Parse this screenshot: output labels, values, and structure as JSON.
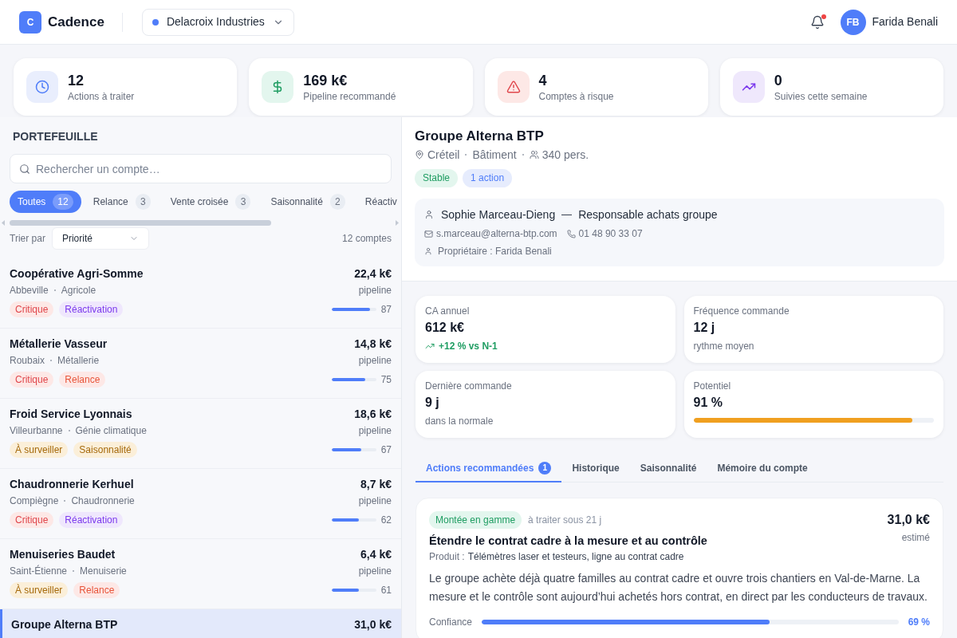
{
  "header": {
    "logo_letter": "C",
    "app_name": "Cadence",
    "organization": "Delacroix Industries",
    "notifications": {
      "unread": true
    },
    "user": {
      "initials": "FB",
      "name": "Farida Benali"
    }
  },
  "kpis": [
    {
      "kind": "actions",
      "value": "12",
      "label": "Actions à traiter"
    },
    {
      "kind": "pipeline",
      "value": "169 k€",
      "label": "Pipeline recommandé"
    },
    {
      "kind": "risk",
      "value": "4",
      "label": "Comptes à risque"
    },
    {
      "kind": "followup",
      "value": "0",
      "label": "Suivies cette semaine"
    }
  ],
  "portfolio": {
    "title": "PORTEFEUILLE",
    "search": {
      "placeholder": "Rechercher un compte…"
    },
    "filters": [
      {
        "label": "Toutes",
        "count": "12",
        "selected": true
      },
      {
        "label": "Relance",
        "count": "3",
        "selected": false
      },
      {
        "label": "Vente croisée",
        "count": "3",
        "selected": false
      },
      {
        "label": "Saisonnalité",
        "count": "2",
        "selected": false
      },
      {
        "label": "Réactiv",
        "selected": false
      }
    ],
    "sort": {
      "label": "Trier par",
      "value": "Priorité"
    },
    "count": "12 comptes",
    "accounts": [
      {
        "name": "Coopérative Agri-Somme",
        "city": "Abbeville",
        "sector": "Agricole",
        "tags": [
          {
            "kind": "critical",
            "label": "Critique"
          },
          {
            "kind": "reactivation",
            "label": "Réactivation"
          }
        ],
        "amount": "22,4 k€",
        "amount_note": "pipeline",
        "level": 0.87,
        "score": "87",
        "selected": false
      },
      {
        "name": "Métallerie Vasseur",
        "city": "Roubaix",
        "sector": "Métallerie",
        "tags": [
          {
            "kind": "critical",
            "label": "Critique"
          },
          {
            "kind": "followup",
            "label": "Relance"
          }
        ],
        "amount": "14,8 k€",
        "amount_note": "pipeline",
        "level": 0.75,
        "score": "75",
        "selected": false
      },
      {
        "name": "Froid Service Lyonnais",
        "city": "Villeurbanne",
        "sector": "Génie climatique",
        "tags": [
          {
            "kind": "watch",
            "label": "À surveiller"
          },
          {
            "kind": "seasonal",
            "label": "Saisonnalité"
          }
        ],
        "amount": "18,6 k€",
        "amount_note": "pipeline",
        "level": 0.67,
        "score": "67",
        "selected": false
      },
      {
        "name": "Chaudronnerie Kerhuel",
        "city": "Compiègne",
        "sector": "Chaudronnerie",
        "tags": [
          {
            "kind": "critical",
            "label": "Critique"
          },
          {
            "kind": "reactivation",
            "label": "Réactivation"
          }
        ],
        "amount": "8,7 k€",
        "amount_note": "pipeline",
        "level": 0.62,
        "score": "62",
        "selected": false
      },
      {
        "name": "Menuiseries Baudet",
        "city": "Saint-Étienne",
        "sector": "Menuiserie",
        "tags": [
          {
            "kind": "watch",
            "label": "À surveiller"
          },
          {
            "kind": "followup",
            "label": "Relance"
          }
        ],
        "amount": "6,4 k€",
        "amount_note": "pipeline",
        "level": 0.61,
        "score": "61",
        "selected": false
      },
      {
        "name": "Groupe Alterna BTP",
        "amount": "31,0 k€",
        "selected": true
      }
    ]
  },
  "account": {
    "name": "Groupe Alterna BTP",
    "city": "Créteil",
    "sector": "Bâtiment",
    "headcount": "340 pers.",
    "badges": [
      {
        "kind": "status",
        "label": "Stable"
      },
      {
        "kind": "count",
        "label": "1 action"
      }
    ],
    "contact": {
      "name": "Sophie Marceau-Dieng",
      "role": "Responsable achats groupe",
      "email": "s.marceau@alterna-btp.com",
      "phone": "01 48 90 33 07",
      "owner": "Propriétaire : Farida Benali"
    },
    "metrics": [
      {
        "kind": "trend",
        "label": "CA annuel",
        "value": "612 k€",
        "note": "+12 % vs N-1"
      },
      {
        "kind": "note",
        "label": "Fréquence commande",
        "value": "12 j",
        "note": "rythme moyen"
      },
      {
        "kind": "note",
        "label": "Dernière commande",
        "value": "9 j",
        "note": "dans la normale"
      },
      {
        "kind": "meter",
        "label": "Potentiel",
        "value": "91 %",
        "level": 0.91
      }
    ],
    "tabs": [
      {
        "label": "Actions recommandées",
        "count": "1",
        "selected": true
      },
      {
        "label": "Historique",
        "selected": false
      },
      {
        "label": "Saisonnalité",
        "selected": false
      },
      {
        "label": "Mémoire du compte",
        "selected": false
      }
    ],
    "actions": [
      {
        "type": "Montée en gamme",
        "deadline": "à traiter sous 21 j",
        "amount": "31,0 k€",
        "amount_note": "estimé",
        "title": "Étendre le contrat cadre à la mesure et au contrôle",
        "product_label": "Produit :",
        "product": "Télémètres laser et testeurs, ligne au contrat cadre",
        "description": "Le groupe achète déjà quatre familles au contrat cadre et ouvre trois chantiers en Val-de-Marne. La mesure et le contrôle sont aujourd’hui achetés hors contrat, en direct par les conducteurs de travaux.",
        "confidence_label": "Confiance",
        "level": 0.69,
        "confidence": "69 %"
      }
    ]
  }
}
